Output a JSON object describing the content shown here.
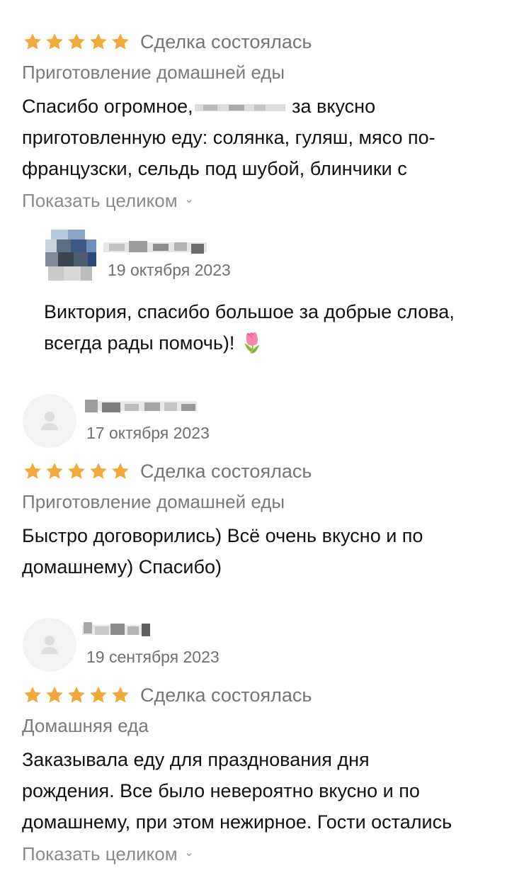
{
  "review1": {
    "status": "Сделка состоялась",
    "category": "Приготовление домашней еды",
    "text_part1": "Спасибо огромное,",
    "text_part2": "за вкусно",
    "text_line2": "приготовленную еду: солянка, гуляш, мясо по-",
    "text_line3": "французски, сельдь под шубой, блинчики с",
    "show_more": "Показать целиком",
    "rating": 5
  },
  "reply1": {
    "date": "19 октября 2023",
    "text_line1": "Виктория, спасибо большое за добрые слова,",
    "text_line2": "всегда рады помочь)!",
    "emoji": "🌷"
  },
  "review2": {
    "date": "17 октября 2023",
    "status": "Сделка состоялась",
    "category": "Приготовление домашней еды",
    "text_line1": "Быстро договорились) Всё очень вкусно и по",
    "text_line2": "домашнему) Спасибо)",
    "rating": 5
  },
  "review3": {
    "date": "19 сентября 2023",
    "status": "Сделка состоялась",
    "category": "Домашняя еда",
    "text_line1": "Заказывала еду для празднования дня",
    "text_line2": "рождения. Все было невероятно вкусно и по",
    "text_line3": "домашнему, при этом нежирное. Гости остались",
    "show_more": "Показать целиком",
    "rating": 5
  },
  "colors": {
    "star": "#F2A93B",
    "muted_text": "#7a7a7a",
    "avatar_bg": "#f3f3f3"
  }
}
